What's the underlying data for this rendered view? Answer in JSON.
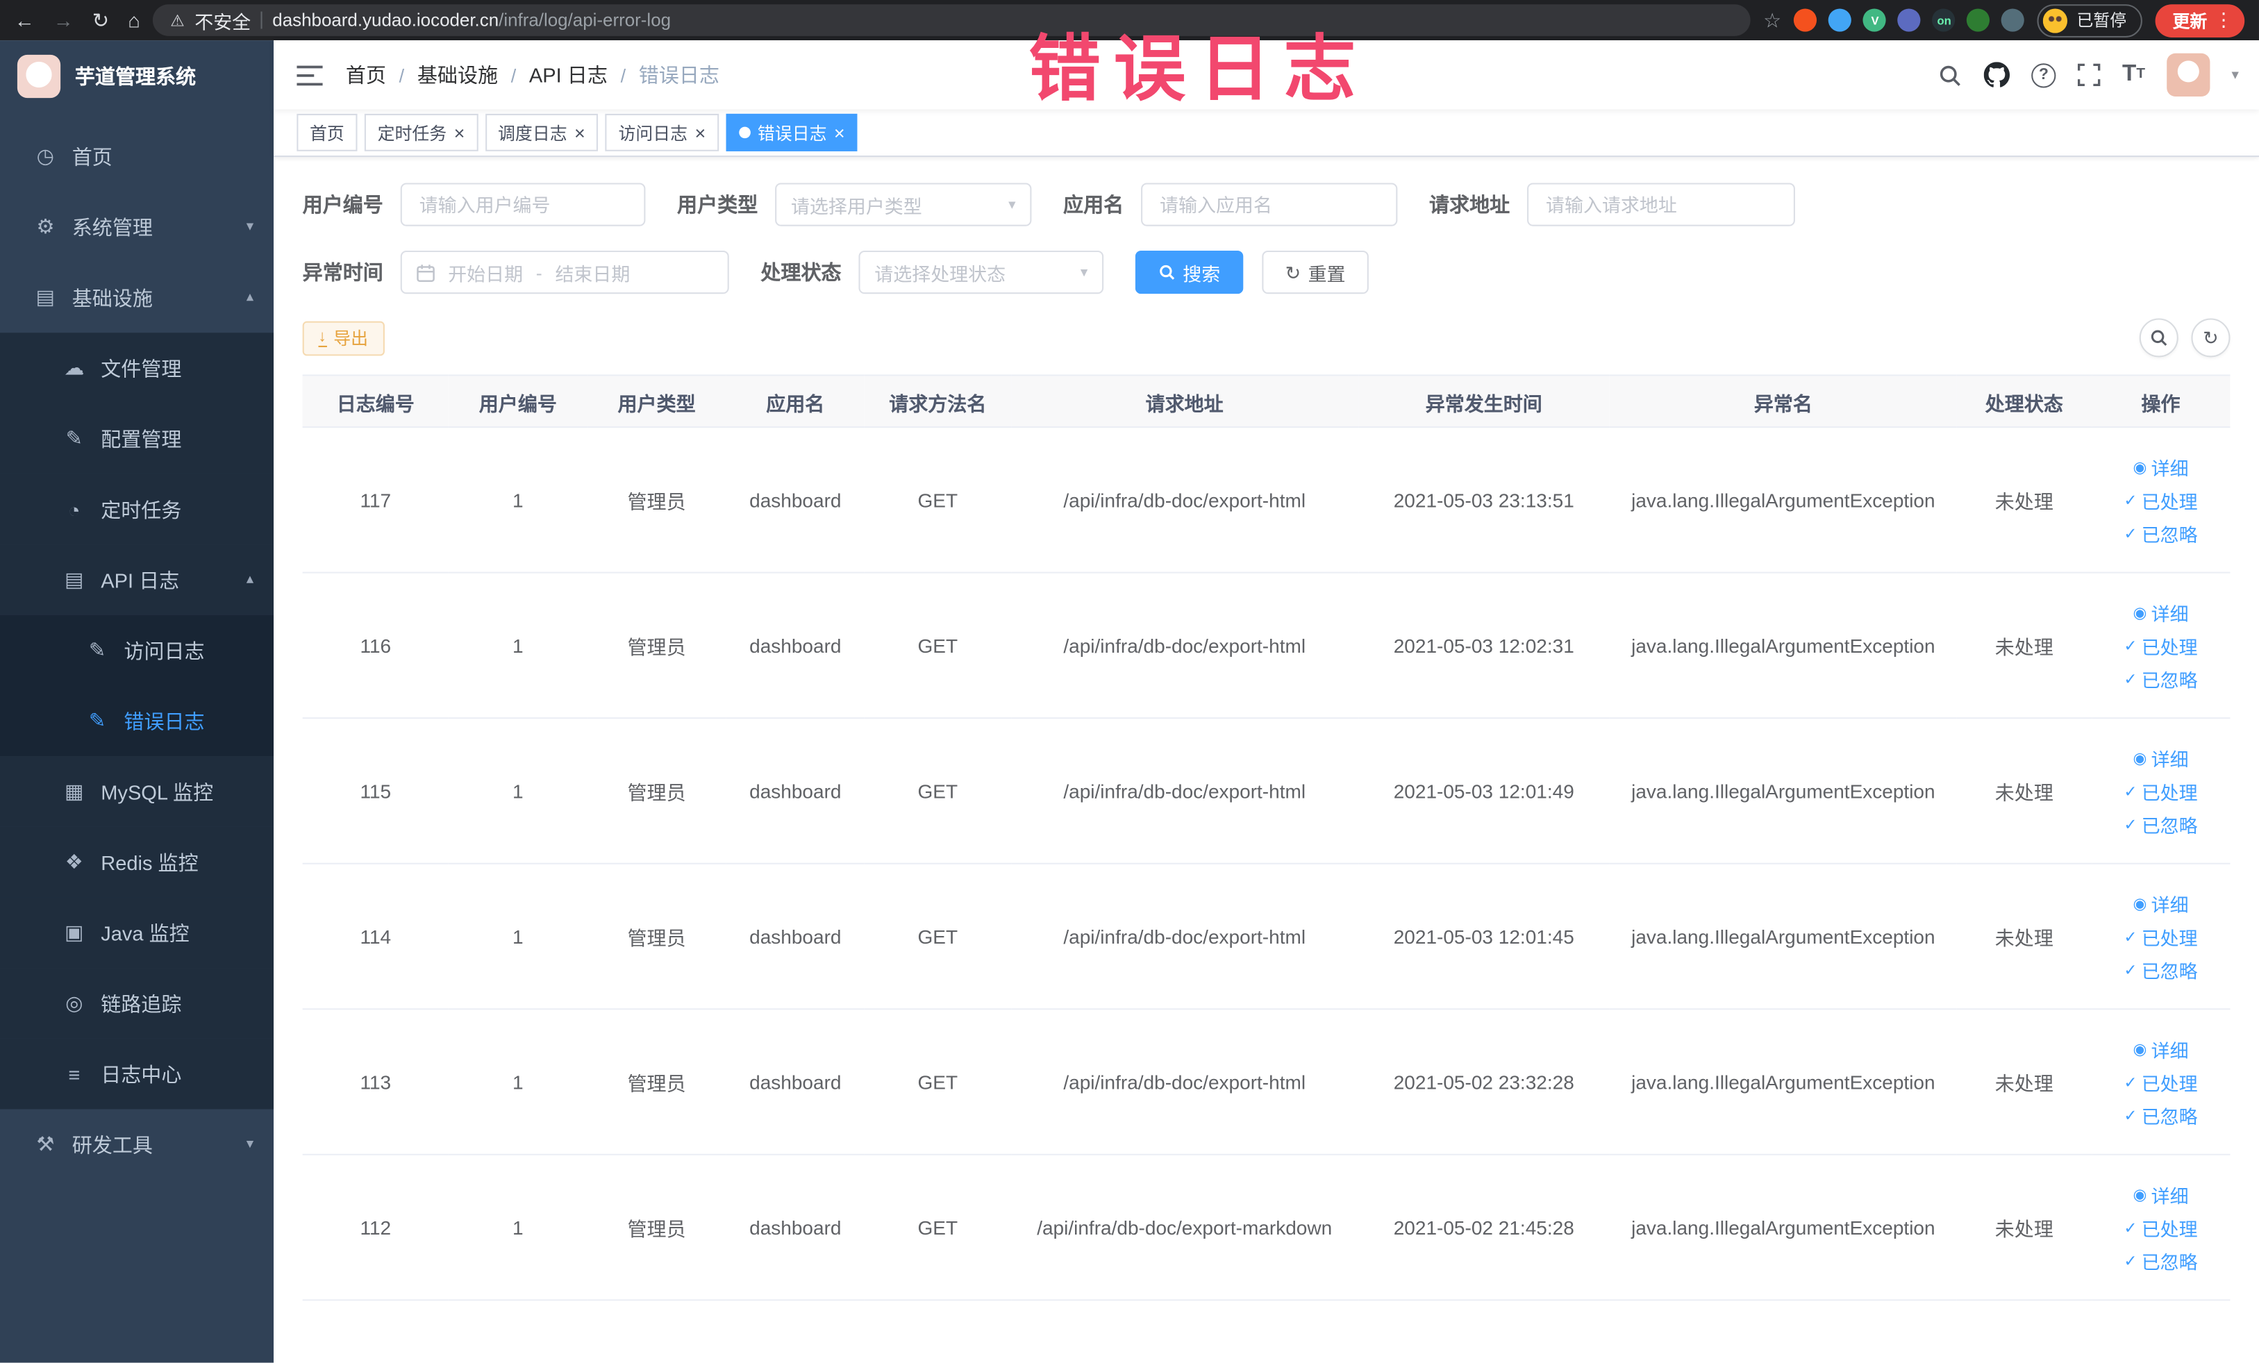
{
  "colors": {
    "accent": "#409eff",
    "warning": "#e6a23c",
    "annotation_pink": "#f2486e",
    "sidebar_bg": "#304156",
    "active_tab": "#409eff"
  },
  "browser": {
    "security_label": "不安全",
    "url_host": "dashboard.yudao.iocoder.cn",
    "url_path": "/infra/log/api-error-log",
    "paused_badge": "已暂停",
    "update_button": "更新",
    "extensions": [
      {
        "name": "extension-lighthouse-icon",
        "color": "#f4511e"
      },
      {
        "name": "extension-drop-icon",
        "color": "#42a5f5"
      },
      {
        "name": "extension-vue-icon",
        "color": "#41b883",
        "label": "V",
        "label_color": "#ffffff"
      },
      {
        "name": "extension-grid-icon",
        "color": "#5c6bc0"
      },
      {
        "name": "extension-on-badge-icon",
        "color": "#263238",
        "label": "on",
        "label_color": "#69f0ae"
      },
      {
        "name": "extension-tree-icon",
        "color": "#2e7d32"
      },
      {
        "name": "extension-paw-icon",
        "color": "#546e7a"
      }
    ]
  },
  "annotation": {
    "text": "错误日志"
  },
  "sidebar": {
    "logo_title": "芋道管理系统",
    "items": [
      {
        "key": "home",
        "label": "首页",
        "icon": "dashboard-icon",
        "level": 1
      },
      {
        "key": "system-management",
        "label": "系统管理",
        "icon": "gear-icon",
        "level": 1,
        "expandable": true,
        "expanded": false
      },
      {
        "key": "infrastructure",
        "label": "基础设施",
        "icon": "infra-icon",
        "level": 1,
        "expandable": true,
        "expanded": true
      },
      {
        "key": "file-management",
        "label": "文件管理",
        "icon": "cloud-icon",
        "level": 2
      },
      {
        "key": "config-management",
        "label": "配置管理",
        "icon": "edit-icon",
        "level": 2
      },
      {
        "key": "scheduled-tasks",
        "label": "定时任务",
        "icon": "timer-icon",
        "level": 2
      },
      {
        "key": "api-logs",
        "label": "API 日志",
        "icon": "log-icon",
        "level": 2,
        "expandable": true,
        "expanded": true
      },
      {
        "key": "access-log",
        "label": "访问日志",
        "icon": "doc-icon",
        "level": 3
      },
      {
        "key": "error-log",
        "label": "错误日志",
        "icon": "doc-icon",
        "level": 3,
        "active": true
      },
      {
        "key": "mysql-monitor",
        "label": "MySQL 监控",
        "icon": "grid-icon",
        "level": 2
      },
      {
        "key": "redis-monitor",
        "label": "Redis 监控",
        "icon": "layers-icon",
        "level": 2
      },
      {
        "key": "java-monitor",
        "label": "Java 监控",
        "icon": "monitor-icon",
        "level": 2
      },
      {
        "key": "link-tracing",
        "label": "链路追踪",
        "icon": "trace-icon",
        "level": 2
      },
      {
        "key": "log-center",
        "label": "日志中心",
        "icon": "log-center-icon",
        "level": 2
      },
      {
        "key": "dev-tools",
        "label": "研发工具",
        "icon": "tools-icon",
        "level": 1,
        "expandable": true,
        "expanded": false
      }
    ]
  },
  "header": {
    "breadcrumb": [
      "首页",
      "基础设施",
      "API 日志",
      "错误日志"
    ]
  },
  "tabs": [
    {
      "key": "home",
      "label": "首页",
      "closable": false,
      "active": false
    },
    {
      "key": "scheduled-tasks",
      "label": "定时任务",
      "closable": true,
      "active": false
    },
    {
      "key": "schedule-log",
      "label": "调度日志",
      "closable": true,
      "active": false
    },
    {
      "key": "access-log",
      "label": "访问日志",
      "closable": true,
      "active": false
    },
    {
      "key": "error-log",
      "label": "错误日志",
      "closable": true,
      "active": true
    }
  ],
  "filters": {
    "user_id": {
      "label": "用户编号",
      "placeholder": "请输入用户编号"
    },
    "user_type": {
      "label": "用户类型",
      "placeholder": "请选择用户类型"
    },
    "app_name": {
      "label": "应用名",
      "placeholder": "请输入应用名"
    },
    "request_url": {
      "label": "请求地址",
      "placeholder": "请输入请求地址"
    },
    "exception_time": {
      "label": "异常时间",
      "start_placeholder": "开始日期",
      "separator": "-",
      "end_placeholder": "结束日期"
    },
    "process_status": {
      "label": "处理状态",
      "placeholder": "请选择处理状态"
    },
    "search_button": "搜索",
    "reset_button": "重置"
  },
  "toolbar": {
    "export_button": "导出"
  },
  "table": {
    "columns": [
      "日志编号",
      "用户编号",
      "用户类型",
      "应用名",
      "请求方法名",
      "请求地址",
      "异常发生时间",
      "异常名",
      "处理状态",
      "操作"
    ],
    "actions": [
      "详细",
      "已处理",
      "已忽略"
    ],
    "rows": [
      {
        "id": "117",
        "user_id": "1",
        "user_type": "管理员",
        "app": "dashboard",
        "method": "GET",
        "url": "/api/infra/db-doc/export-html",
        "time": "2021-05-03 23:13:51",
        "exception": "java.lang.IllegalArgumentException",
        "status": "未处理"
      },
      {
        "id": "116",
        "user_id": "1",
        "user_type": "管理员",
        "app": "dashboard",
        "method": "GET",
        "url": "/api/infra/db-doc/export-html",
        "time": "2021-05-03 12:02:31",
        "exception": "java.lang.IllegalArgumentException",
        "status": "未处理"
      },
      {
        "id": "115",
        "user_id": "1",
        "user_type": "管理员",
        "app": "dashboard",
        "method": "GET",
        "url": "/api/infra/db-doc/export-html",
        "time": "2021-05-03 12:01:49",
        "exception": "java.lang.IllegalArgumentException",
        "status": "未处理"
      },
      {
        "id": "114",
        "user_id": "1",
        "user_type": "管理员",
        "app": "dashboard",
        "method": "GET",
        "url": "/api/infra/db-doc/export-html",
        "time": "2021-05-03 12:01:45",
        "exception": "java.lang.IllegalArgumentException",
        "status": "未处理"
      },
      {
        "id": "113",
        "user_id": "1",
        "user_type": "管理员",
        "app": "dashboard",
        "method": "GET",
        "url": "/api/infra/db-doc/export-html",
        "time": "2021-05-02 23:32:28",
        "exception": "java.lang.IllegalArgumentException",
        "status": "未处理"
      },
      {
        "id": "112",
        "user_id": "1",
        "user_type": "管理员",
        "app": "dashboard",
        "method": "GET",
        "url": "/api/infra/db-doc/export-markdown",
        "time": "2021-05-02 21:45:28",
        "exception": "java.lang.IllegalArgumentException",
        "status": "未处理"
      }
    ]
  }
}
